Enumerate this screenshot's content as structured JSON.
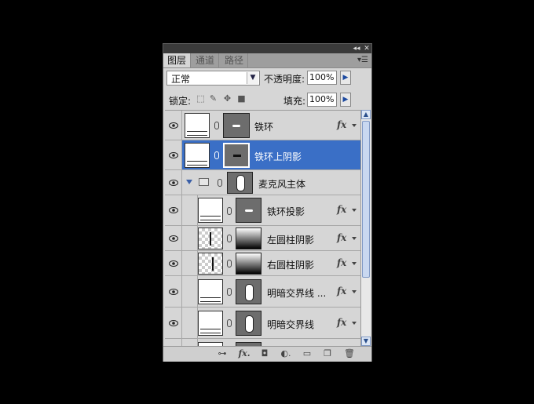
{
  "panel": {
    "tabs": [
      "图层",
      "通道",
      "路径"
    ],
    "active_tab": "图层",
    "blend_mode": "正常",
    "opacity_label": "不透明度:",
    "opacity_value": "100%",
    "lock_label": "锁定:",
    "fill_label": "填充:",
    "fill_value": "100%"
  },
  "layers": [
    {
      "name": "铁环",
      "fx": "fx"
    },
    {
      "name": "铁环上阴影"
    },
    {
      "name": "麦克风主体"
    },
    {
      "name": "铁环投影",
      "fx": "fx"
    },
    {
      "name": "左圆柱阴影",
      "fx": "fx"
    },
    {
      "name": "右圆柱阴影",
      "fx": "fx"
    },
    {
      "name": "明暗交界线 ...",
      "fx": "fx"
    },
    {
      "name": "明暗交界线",
      "fx": "fx"
    }
  ],
  "bottom_toolbar": {
    "fx_label": "fx."
  },
  "icons": [
    "collapse-icon",
    "close-icon",
    "panel-menu-icon",
    "eye-icon",
    "chain-icon",
    "folder-icon",
    "link-icon",
    "mask-icon",
    "adjustment-icon",
    "new-group-icon",
    "new-layer-icon",
    "trash-icon"
  ],
  "colors": {
    "selection": "#3a6fc6",
    "panel_bg": "#d6d6d6"
  }
}
